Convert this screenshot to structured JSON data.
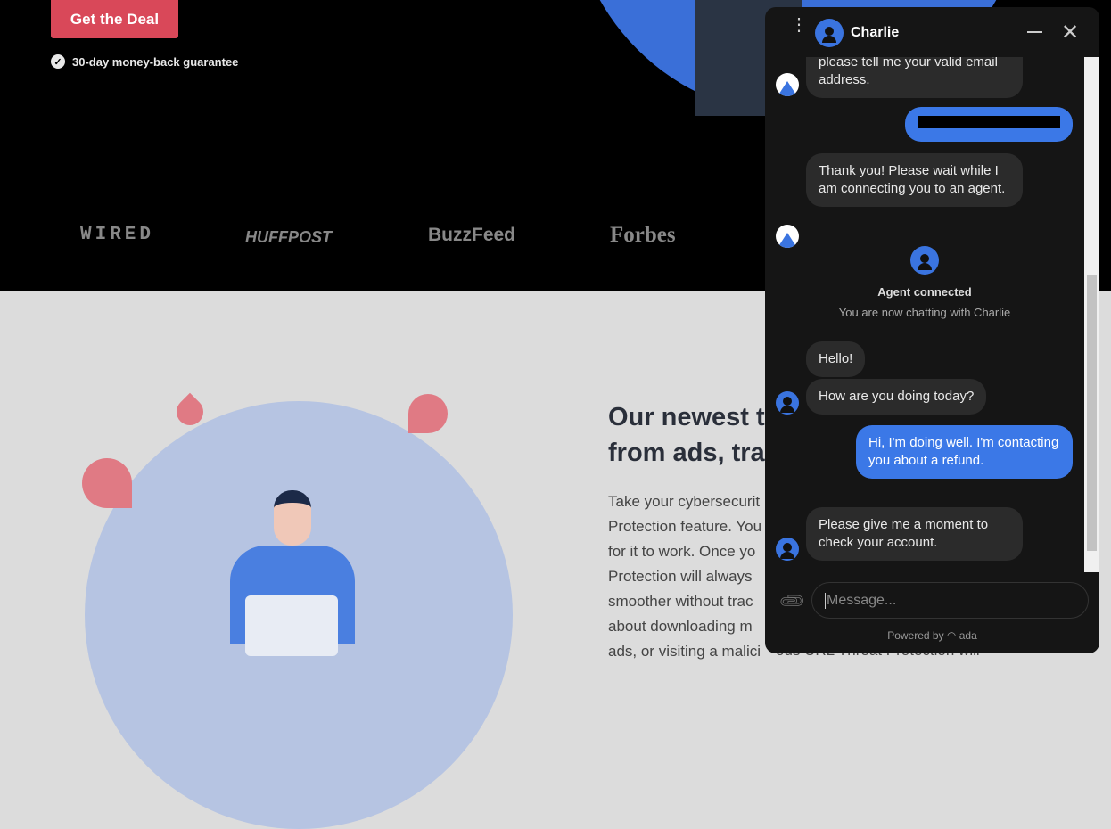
{
  "hero": {
    "cta": "Get the Deal",
    "guarantee": "30-day money-back guarantee",
    "press": [
      "WIRED",
      "HUFFPOST",
      "BuzzFeed",
      "Forbes"
    ]
  },
  "feature": {
    "heading_lines": [
      "Our newest t",
      "from ads, tra"
    ],
    "body_lines": [
      "Take your cybersecurit",
      "Protection feature. You",
      "for it to work. Once yo",
      "Protection will always",
      "smoother without trac",
      "about downloading m",
      "ads, or visiting a malici"
    ],
    "behind_text": "ous URL     Threat Protection will"
  },
  "chat": {
    "agent_name": "Charlie",
    "messages": [
      {
        "from": "bot",
        "text": "please tell me your valid email address."
      },
      {
        "from": "user",
        "text": ""
      },
      {
        "from": "bot",
        "text": "Thank you! Please wait while I am connecting you to an agent."
      },
      {
        "from": "agent",
        "text": "Hello!"
      },
      {
        "from": "agent",
        "text": "How are you doing today?"
      },
      {
        "from": "user",
        "text": "Hi, I'm doing well. I'm contacting you about a refund."
      },
      {
        "from": "agent",
        "text": "Please give me a moment to check your account."
      }
    ],
    "status_title": "Agent connected",
    "status_sub": "You are now chatting with Charlie",
    "input_placeholder": "Message...",
    "powered_by": "Powered by",
    "brand": "ada",
    "accent": "#3b78e7"
  }
}
